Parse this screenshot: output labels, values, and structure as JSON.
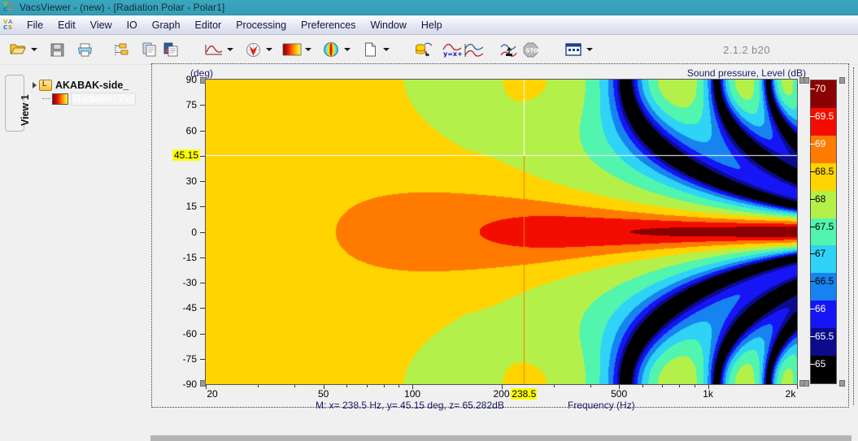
{
  "window": {
    "title": "VacsViewer - (new) - [Radiation Polar - Polar1]",
    "logo": "vacs-logo-icon",
    "version": "2.1.2 b20"
  },
  "menu": {
    "items": [
      {
        "label": "File"
      },
      {
        "label": "Edit"
      },
      {
        "label": "View"
      },
      {
        "label": "IO"
      },
      {
        "label": "Graph"
      },
      {
        "label": "Editor"
      },
      {
        "label": "Processing"
      },
      {
        "label": "Preferences"
      },
      {
        "label": "Window"
      },
      {
        "label": "Help"
      }
    ]
  },
  "toolbar": {
    "buttons": [
      {
        "name": "open-folder-icon",
        "dropdown": true
      },
      {
        "name": "save-icon",
        "dropdown": false
      },
      {
        "name": "print-icon",
        "dropdown": false
      },
      {
        "name": "properties-icon",
        "dropdown": false
      },
      {
        "name": "copy-icon",
        "dropdown": false
      },
      {
        "name": "paste-special-icon",
        "dropdown": false
      },
      {
        "name": "curve-chart-icon",
        "dropdown": true
      },
      {
        "name": "polar-target-icon",
        "dropdown": true
      },
      {
        "name": "color-map-icon",
        "dropdown": true
      },
      {
        "name": "balloon-icon",
        "dropdown": true
      },
      {
        "name": "new-page-icon",
        "dropdown": true
      },
      {
        "name": "data-import-icon",
        "dropdown": false
      },
      {
        "name": "formula-curve-icon",
        "dropdown": false
      },
      {
        "name": "overlay-curve-icon",
        "dropdown": false
      },
      {
        "name": "export-curve-icon",
        "dropdown": false
      },
      {
        "name": "stop-icon",
        "dropdown": false
      },
      {
        "name": "table-icon",
        "dropdown": true
      }
    ]
  },
  "sidebar": {
    "view_tab_label": "View 1",
    "tree": [
      {
        "label": "AKABAK-side_",
        "icon": "folder-icon",
        "selected": false,
        "level": 0
      },
      {
        "label": "Radiation Pol",
        "icon": "gradient-icon",
        "selected": true,
        "level": 1
      }
    ]
  },
  "chart_data": {
    "type": "heatmap",
    "title": "Sound pressure, Level  (dB)",
    "xlabel": "Frequency  (Hz)",
    "ylabel": "(deg)",
    "xscale": "log",
    "xlim": [
      20,
      2000
    ],
    "ylim": [
      -90,
      90
    ],
    "xticks": [
      "20",
      "50",
      "100",
      "200",
      "500",
      "1k",
      "2k"
    ],
    "xtick_values": [
      20,
      50,
      100,
      200,
      500,
      1000,
      2000
    ],
    "yticks": [
      "90",
      "75",
      "60",
      "45",
      "30",
      "15",
      "0",
      "-15",
      "-30",
      "-45",
      "-60",
      "-75",
      "-90"
    ],
    "ytick_values": [
      90,
      75,
      60,
      45,
      30,
      15,
      0,
      -15,
      -30,
      -45,
      -60,
      -75,
      -90
    ],
    "grid": false,
    "colorbar": {
      "label": "Level (dB)",
      "min": 65,
      "max": 70,
      "step": 0.5,
      "ticks": [
        "70",
        "69.5",
        "69",
        "68.5",
        "68",
        "67.5",
        "67",
        "66.5",
        "66",
        "65.5",
        "65"
      ],
      "tick_values": [
        70,
        69.5,
        69,
        68.5,
        68,
        67.5,
        67,
        66.5,
        66,
        65.5,
        65
      ],
      "colors": [
        {
          "level": 70,
          "hex": "#8B0000"
        },
        {
          "level": 69.5,
          "hex": "#F30D00"
        },
        {
          "level": 69,
          "hex": "#FF7B00"
        },
        {
          "level": 68.5,
          "hex": "#FFD400"
        },
        {
          "level": 68,
          "hex": "#B4F04A"
        },
        {
          "level": 67.5,
          "hex": "#52F5AE"
        },
        {
          "level": 67,
          "hex": "#2ED3F5"
        },
        {
          "level": 66.5,
          "hex": "#1783F0"
        },
        {
          "level": 66,
          "hex": "#1515F5"
        },
        {
          "level": 65.5,
          "hex": "#0B0B8C"
        },
        {
          "level": 65,
          "hex": "#000000"
        }
      ]
    },
    "cursor": {
      "x_label": "238.5",
      "y_label": "45.15",
      "x_hz": 238.5,
      "y_deg": 45.15,
      "z_db": 65.282,
      "color": "#FFFF00"
    },
    "readout": "M:  x= 238.5 Hz,  y= 45.15 deg,  z= 65.282dB"
  }
}
